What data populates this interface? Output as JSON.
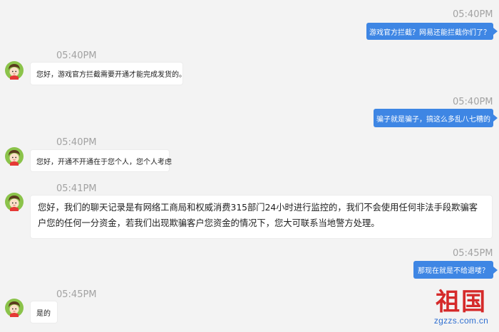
{
  "messages": [
    {
      "time": "05:40PM",
      "side": "right",
      "text": "游戏官方拦截？网易还能拦截你们了？"
    },
    {
      "time": "05:40PM",
      "side": "left",
      "text": "您好，游戏官方拦截需要开通才能完成发货的。"
    },
    {
      "time": "05:40PM",
      "side": "right",
      "text": "骗子就是骗子，搞这么多乱八七糟的"
    },
    {
      "time": "05:40PM",
      "side": "left",
      "text": "您好，开通不开通在于您个人，您个人考虑"
    },
    {
      "time": "05:41PM",
      "side": "left",
      "text": "您好，我们的聊天记录是有网络工商局和权威消费315部门24小时进行监控的，我们不会使用任何非法手段欺骗客户您的任何一分资金，若我们出现欺骗客户您资金的情况下，您大可联系当地警方处理。"
    },
    {
      "time": "05:45PM",
      "side": "right",
      "text": "那现在就是不给退喽？"
    },
    {
      "time": "05:45PM",
      "side": "left",
      "text": "是的"
    }
  ],
  "watermark": {
    "title": "祖国",
    "url": "zgzzs.com.cn"
  },
  "colors": {
    "background": "#f3f3f3",
    "right_bubble": "#3e86e4",
    "left_bubble": "#ffffff",
    "timestamp": "#a2a2a2",
    "watermark_red": "#d52a2a",
    "watermark_blue": "#2f6fd1"
  }
}
